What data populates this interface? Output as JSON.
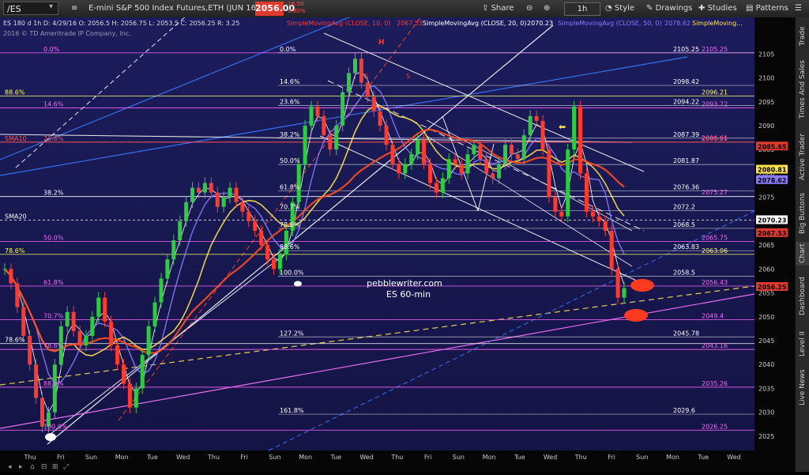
{
  "header": {
    "symbol": "/ES",
    "description": "E-mini S&P 500 Index Futures,ETH (JUN 16)",
    "last_price": "2056.00",
    "change": "-16.50",
    "change_pct": "-0.80%",
    "interval": "1h",
    "buttons": [
      "Share",
      "Style",
      "Drawings",
      "Studies",
      "Patterns"
    ]
  },
  "chart_header": {
    "ohlc": "ES 180 d 1h  D: 4/29/16 O: 2056.5  H: 2056.75  L: 2053.5  C: 2056.25  R: 3.25",
    "copyright": "2016 © TD Ameritrade IP Company, Inc.",
    "studies": [
      {
        "label": "SimpleMovingAvg (CLOSE, 10, 0)",
        "value": "2067.53",
        "color": "#ff3b2f"
      },
      {
        "label": "SimpleMovingAvg (CLOSE, 20, 0)",
        "value": "2070.23",
        "color": "#ffffff"
      },
      {
        "label": "SimpleMovingAvg (CLOSE, 50, 0)",
        "value": "2078.62",
        "color": "#8a7bff"
      },
      {
        "label": "SimpleMoving...",
        "value": "",
        "color": "#ffe14d"
      }
    ]
  },
  "sidebar_tabs": [
    "Trade",
    "Times And Sales",
    "Active Trader",
    "Big Buttons",
    "Chart",
    "Dashboard",
    "Level II",
    "Live News"
  ],
  "chart_data": {
    "type": "line",
    "ylim": [
      2022.5,
      2112
    ],
    "yticks": [
      2025,
      2030,
      2035,
      2040,
      2045,
      2050,
      2055,
      2060,
      2065,
      2070,
      2075,
      2080,
      2085,
      2090,
      2095,
      2100,
      2105
    ],
    "xticks": [
      "Thu",
      "Fri",
      "Sun",
      "Mon",
      "Tue",
      "Wed",
      "Thu",
      "Fri",
      "Sun",
      "Mon",
      "Tue",
      "Wed",
      "Thu",
      "Fri",
      "Sun",
      "Mon",
      "Tue",
      "Wed",
      "Thu",
      "Fri",
      "Sun",
      "Mon",
      "Tue",
      "Wed"
    ],
    "price_series": [
      2060,
      2057,
      2052,
      2046,
      2040,
      2033,
      2027,
      2030,
      2040,
      2048,
      2051,
      2047,
      2044,
      2046,
      2050,
      2054,
      2049,
      2044,
      2040,
      2036,
      2031,
      2035,
      2042,
      2048,
      2053,
      2058,
      2062,
      2066,
      2070,
      2074,
      2077,
      2076,
      2078,
      2076,
      2073,
      2075,
      2077,
      2074,
      2072,
      2070,
      2068,
      2065,
      2062,
      2060,
      2063,
      2068,
      2074,
      2082,
      2090,
      2094,
      2092,
      2088,
      2085,
      2090,
      2097,
      2101,
      2104,
      2099,
      2096,
      2093,
      2090,
      2086,
      2082,
      2080,
      2082,
      2084,
      2087,
      2082,
      2078,
      2076,
      2079,
      2083,
      2082,
      2080,
      2084,
      2086,
      2083,
      2080,
      2079,
      2082,
      2086,
      2084,
      2083,
      2088,
      2092,
      2091,
      2085,
      2075,
      2072,
      2071,
      2085,
      2094,
      2080,
      2072,
      2071,
      2070,
      2068,
      2060,
      2054,
      2056
    ],
    "moving_averages": [
      {
        "name": "SMA10",
        "value": 2067.53,
        "color": "#ff3b2f"
      },
      {
        "name": "SMA20",
        "value": 2070.23,
        "color": "#ffffff"
      },
      {
        "name": "SMA50",
        "value": 2078.62,
        "color": "#8a7bff"
      }
    ],
    "fib_left": [
      {
        "label": "0.0%",
        "y": 2105.25
      },
      {
        "label": "88.6%",
        "y": 2096.21
      },
      {
        "label": "14.6%",
        "y": 2093.72
      },
      {
        "label": "23.6%",
        "y": 2086.55
      },
      {
        "label": "SMA10",
        "y": 2086.55
      },
      {
        "label": "38.2%",
        "y": 2075.17
      },
      {
        "label": "SMA20",
        "y": 2070.23
      },
      {
        "label": "50.0%",
        "y": 2065.75
      },
      {
        "label": "78.6%",
        "y": 2063.06
      },
      {
        "label": "61.8%",
        "y": 2056.43
      },
      {
        "label": "70.7%",
        "y": 2049.4
      },
      {
        "label": "78.6%",
        "y": 2044.39
      },
      {
        "label": "78.6%",
        "y": 2043.16
      },
      {
        "label": "88.6%",
        "y": 2035.26
      },
      {
        "label": "100.0%",
        "y": 2026.25
      }
    ],
    "fib_mid": [
      {
        "label": "0.0%",
        "value": "2105.25",
        "y": 2105.25
      },
      {
        "label": "14.6%",
        "value": "2098.42",
        "y": 2098.42
      },
      {
        "label": "23.6%",
        "value": "2094.22",
        "y": 2094.22
      },
      {
        "label": "38.2%",
        "value": "2087.39",
        "y": 2087.39
      },
      {
        "label": "50.0%",
        "value": "2081.87",
        "y": 2081.87
      },
      {
        "label": "61.8%",
        "value": "2076.36",
        "y": 2076.36
      },
      {
        "label": "70.7%",
        "value": "2072.2",
        "y": 2072.2
      },
      {
        "label": "78.6%",
        "value": "2068.5",
        "y": 2068.5
      },
      {
        "label": "88.6%",
        "value": "2063.83",
        "y": 2063.83
      },
      {
        "label": "100.0%",
        "value": "2058.5",
        "y": 2058.5
      },
      {
        "label": "127.2%",
        "value": "2045.78",
        "y": 2045.78
      },
      {
        "label": "161.8%",
        "value": "2029.6",
        "y": 2029.6
      }
    ],
    "right_values": [
      {
        "value": "2105.25",
        "y": 2105.25,
        "color": "#ff66ff"
      },
      {
        "value": "2096.21",
        "y": 2096.21,
        "color": "#ffff66"
      },
      {
        "value": "2093.72",
        "y": 2093.72,
        "color": "#ff66ff"
      },
      {
        "value": "2086.61",
        "y": 2086.61,
        "color": "#ff66ff"
      },
      {
        "value": "2086.55",
        "y": 2086.55,
        "color": "#ff5555"
      },
      {
        "value": "2075.17",
        "y": 2075.17,
        "color": "#ffffff"
      },
      {
        "value": "2075.27",
        "y": 2075.27,
        "color": "#ff66ff"
      },
      {
        "value": "2070.36",
        "y": 2070.36,
        "color": "#ffffff"
      },
      {
        "value": "2065.75",
        "y": 2065.75,
        "color": "#ff66ff"
      },
      {
        "value": "2063.06",
        "y": 2063.06,
        "color": "#ffff66"
      },
      {
        "value": "2056.43",
        "y": 2056.43,
        "color": "#ff66ff"
      },
      {
        "value": "2049.4",
        "y": 2049.4,
        "color": "#ff66ff"
      },
      {
        "value": "2044.39",
        "y": 2044.39,
        "color": "#ffffff"
      },
      {
        "value": "2043.16",
        "y": 2043.16,
        "color": "#ff66ff"
      },
      {
        "value": "2035.26",
        "y": 2035.26,
        "color": "#ff66ff"
      },
      {
        "value": "2026.25",
        "y": 2026.25,
        "color": "#ff66ff"
      }
    ],
    "axis_tags": [
      {
        "value": "2085.65",
        "y": 2085.65,
        "color": "#e03a30"
      },
      {
        "value": "2080.81",
        "y": 2080.81,
        "color": "#ffe14d"
      },
      {
        "value": "2078.62",
        "y": 2078.62,
        "color": "#8a7bff"
      },
      {
        "value": "2070.23",
        "y": 2070.23,
        "color": "#ffffff"
      },
      {
        "value": "2067.53",
        "y": 2067.53,
        "color": "#e03a30"
      },
      {
        "value": "2056.25",
        "y": 2056.25,
        "color": "#e03a30"
      }
    ],
    "annotations": {
      "watermark_line1": "pebblewriter.com",
      "watermark_line2": "ES 60-min",
      "pattern_labels": [
        "H",
        "S",
        "S"
      ]
    }
  }
}
